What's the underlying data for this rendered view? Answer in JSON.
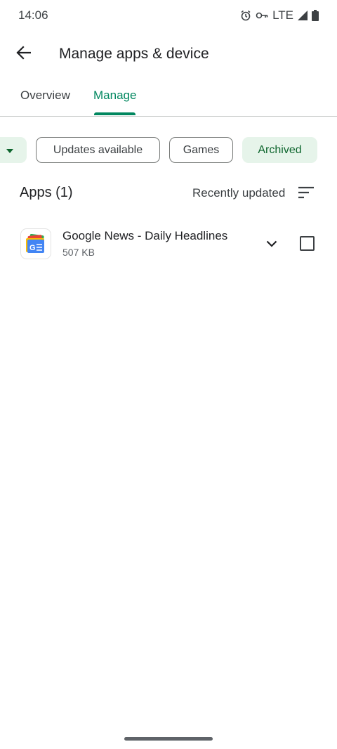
{
  "status_bar": {
    "time": "14:06",
    "network": "LTE",
    "icons": [
      "alarm-icon",
      "vpn-key-icon",
      "signal-icon",
      "battery-icon"
    ]
  },
  "app_bar": {
    "title": "Manage apps & device",
    "back_icon": "arrow-back-icon"
  },
  "tabs": [
    {
      "label": "Overview",
      "selected": false
    },
    {
      "label": "Manage",
      "selected": true
    }
  ],
  "filters": {
    "dropdown_icon": "caret-down-icon",
    "chips": [
      {
        "label": "Updates available",
        "selected": false
      },
      {
        "label": "Games",
        "selected": false
      },
      {
        "label": "Archived",
        "selected": true
      }
    ]
  },
  "list": {
    "heading": "Apps (1)",
    "sort_label": "Recently updated",
    "sort_icon": "sort-icon",
    "items": [
      {
        "name": "Google News - Daily Headlines",
        "size": "507 KB",
        "icon": "google-news-icon",
        "checked": false
      }
    ]
  },
  "colors": {
    "accent": "#01875f",
    "chip_selected_bg": "#e6f4ea",
    "chip_selected_text": "#0d652d",
    "text_primary": "#202124",
    "text_secondary": "#5f6368"
  }
}
